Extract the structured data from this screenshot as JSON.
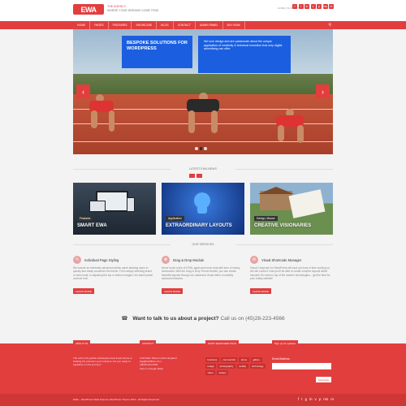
{
  "brand": {
    "logo_text": "EWA",
    "tagline_1": "THE AGENCY",
    "tagline_2": "WHERE YOUR DREAMS COME TRUE",
    "accent": "#e23e3e"
  },
  "header": {
    "top_links": "HOME | SUPPORT",
    "socials": [
      "f",
      "t",
      "in",
      "v",
      "p",
      "rss",
      "m"
    ]
  },
  "nav": {
    "items": [
      "HOME",
      "PAGES",
      "FEATURES",
      "SHOWCASE",
      "BLOG",
      "CONTACT",
      "ADMIN PANEL",
      "BUY NOW"
    ],
    "search_icon": "search-icon"
  },
  "slider": {
    "headline": "BESPOKE SOLUTIONS FOR WORDPRESS",
    "text": "We love design and are passionate about the unique application of creativity & technical execution that only digital advertising can offer.",
    "prev": "‹",
    "next": "›",
    "slides_total": 3,
    "active_slide": 2
  },
  "news": {
    "section_title": "LATEST EWA NEWS",
    "cards": [
      {
        "tag": "Features",
        "title": "SMART EWA"
      },
      {
        "tag": "Application",
        "title": "EXTRAORDINARY LAYOUTS"
      },
      {
        "tag": "Design, Mouse",
        "title": "CREATIVE VISIONARIES"
      }
    ]
  },
  "services": {
    "section_title": "OUR SERVICES",
    "items": [
      {
        "title": "Individual Page Styling",
        "text": "We include an extremely advanced admin panel allowing users to quickly and easily customize the theme. From simply selecting brand or web mode, to adjusting the top or bottom margins, the admin panel controls it all.",
        "button": "LEARN MORE"
      },
      {
        "title": "Drag & Drop Module",
        "text": "Never touch a line of HTML again and never deal with tons of messy shortcodes. With the Drag & Drop Theme Builder, you can create beautiful layouts through our advanced visual editor. Incredibly awesome features.",
        "button": "LEARN MORE"
      },
      {
        "title": "Visual Shortcode Manager",
        "text": "Visual Composer for WordPress will save you tons of time working on the site content. Now you'll be able to create complex layouts within minutes! It's build on top of the modern technologies – get the best for your totally website!",
        "button": "LEARN MORE"
      }
    ]
  },
  "cta": {
    "question": "Want to talk to us about a project?",
    "call_text": "Call us on (45)28-223-4566"
  },
  "footer": {
    "tabs": [
      "ABOUT US",
      "CONTACT",
      "MOST SEARCHED TAGS",
      "Sign up for updates"
    ],
    "about_text": "The ooltl is the global marketplace best loved theme to building the premium your business. Are you ready to capitalize on this journey?",
    "contact_lines": [
      "1234 Main Street London England",
      "(bg@bsaffilieur.com",
      "(45)28-223-4566",
      "Open in Google Maps"
    ],
    "tags": [
      "business",
      "commercial",
      "demo",
      "gallery",
      "image",
      "photography",
      "quality",
      "technology",
      "video",
      "design"
    ],
    "email_label": "Email Address",
    "subscribe_label": "Subscribe",
    "copyright": "EWA – WordPress Multi-Purpose WordPress Theme 2013 - All Rights Reserved",
    "socials": [
      "f",
      "t",
      "g",
      "in",
      "v",
      "p",
      "rss",
      "m"
    ]
  }
}
